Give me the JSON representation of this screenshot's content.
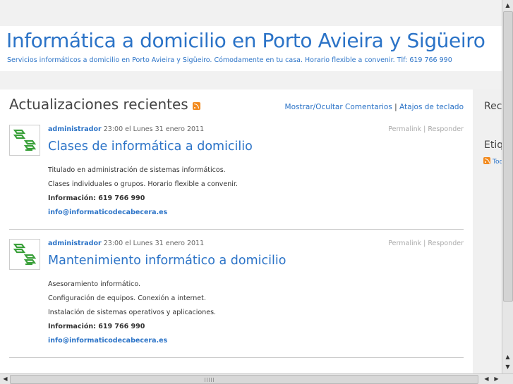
{
  "header": {
    "title": "Informática a domicilio en Porto Avieira y Sigüeiro",
    "description": "Servicios informáticos a domicilio en Porto Avieira y Sigüeiro. Cómodamente en tu casa. Horario flexible a convenir. Tlf: 619 766 990"
  },
  "main": {
    "section_title": "Actualizaciones recientes",
    "toggle_comments": "Mostrar/Ocultar Comentarios",
    "separator": "|",
    "shortcuts": "Atajos de teclado"
  },
  "posts": [
    {
      "author": "administrador",
      "date": "23:00 el Lunes 31 enero 2011",
      "permalink": "Permalink",
      "reply": "Responder",
      "title": "Clases de informática a domicilio",
      "lines": [
        "Titulado en administración de sistemas informáticos.",
        "Clases individuales o grupos. Horario flexible a convenir."
      ],
      "info": "Información: 619 766 990",
      "email": "info@informaticodecabecera.es"
    },
    {
      "author": "administrador",
      "date": "23:00 el Lunes 31 enero 2011",
      "permalink": "Permalink",
      "reply": "Responder",
      "title": "Mantenimiento informático a domicilio",
      "lines": [
        "Asesoramiento informático.",
        "Configuración de equipos. Conexión a internet.",
        "Instalación de sistemas operativos y aplicaciones."
      ],
      "info": "Información: 619 766 990",
      "email": "info@informaticodecabecera.es"
    }
  ],
  "sidebar": {
    "heading1": "Rec",
    "heading2": "Etiq",
    "link": "Tod"
  },
  "colors": {
    "link": "#2b73c7",
    "rss": "#f28a1e",
    "avatar": "#3aa03a"
  },
  "icons": {
    "feed": "rss-icon",
    "avatar": "identicon"
  }
}
